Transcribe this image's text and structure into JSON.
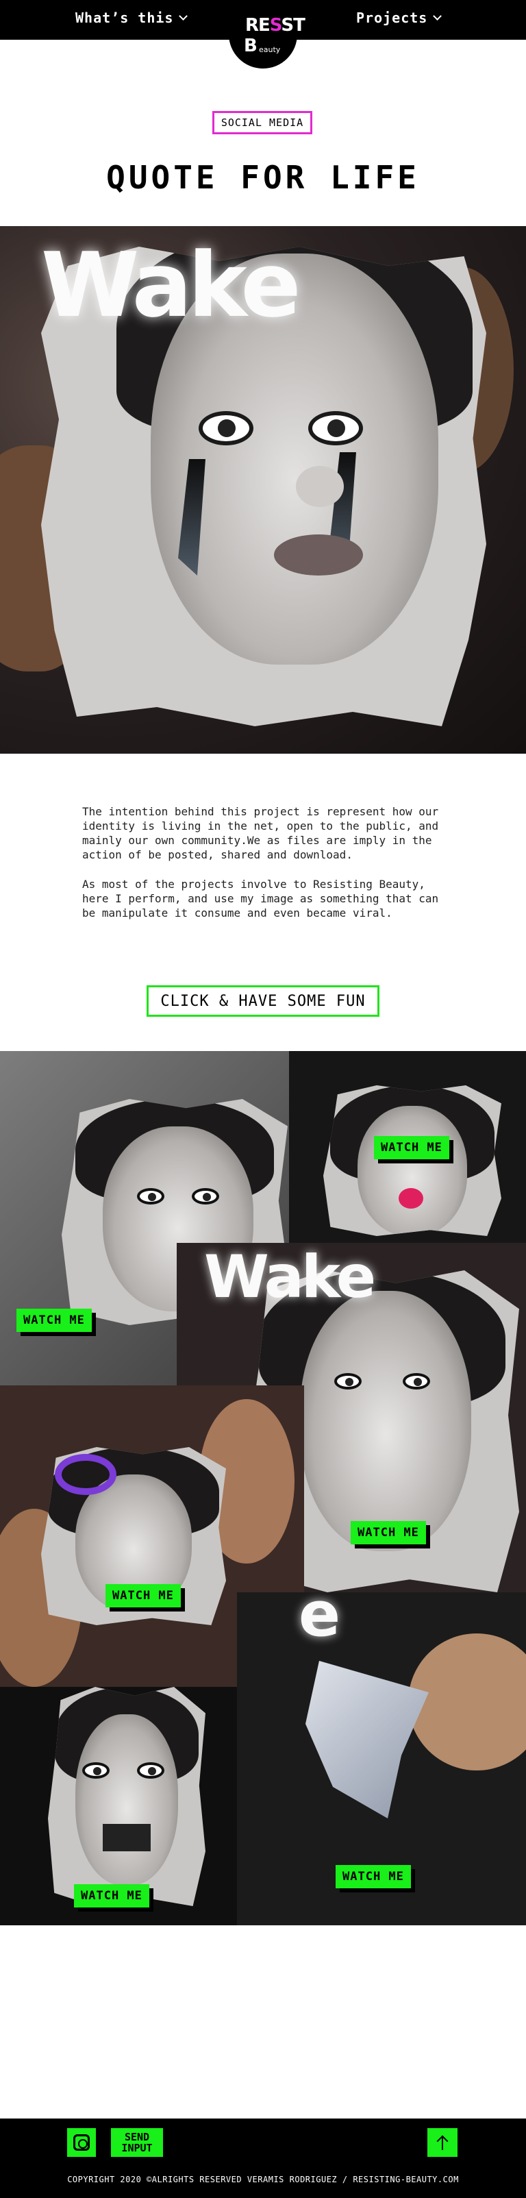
{
  "nav": {
    "whats_this": "What’s this",
    "projects": "Projects"
  },
  "logo": {
    "line1_a": "RE",
    "line1_b": "S",
    "line1_c": "ST",
    "line2": "B",
    "line3": "eauty"
  },
  "header": {
    "tag": "SOCIAL MEDIA",
    "title": "QUOTE FOR LIFE"
  },
  "hero": {
    "word": "Wake"
  },
  "intro": {
    "p1": "The intention behind this project is represent how our identity is living in the net, open to the public, and mainly our own community.We as files are imply in the action of be posted, shared and download.",
    "p2": "As most of the projects involve to Resisting Beauty, here I perform, and use my image as something that can be manipulate it consume and even became viral."
  },
  "cta": {
    "label": "CLICK & HAVE SOME FUN"
  },
  "gallery": {
    "watch_label": "WATCH ME",
    "wake_word": "Wake",
    "e_letter": "e"
  },
  "footer": {
    "send_line1": "SEND",
    "send_line2": "INPUT",
    "copyright": "COPYRIGHT 2020 ©ALRIGHTS RESERVED VERAMIS RODRIGUEZ  / RESISTING-BEAUTY.COM"
  },
  "colors": {
    "accent_green": "#19ef19",
    "accent_pink": "#e22bd0",
    "bar_black": "#000000"
  },
  "icons": {
    "nav_chevron": "chevron-down-icon",
    "social": "instagram-icon",
    "back_to_top": "arrow-up-icon"
  }
}
